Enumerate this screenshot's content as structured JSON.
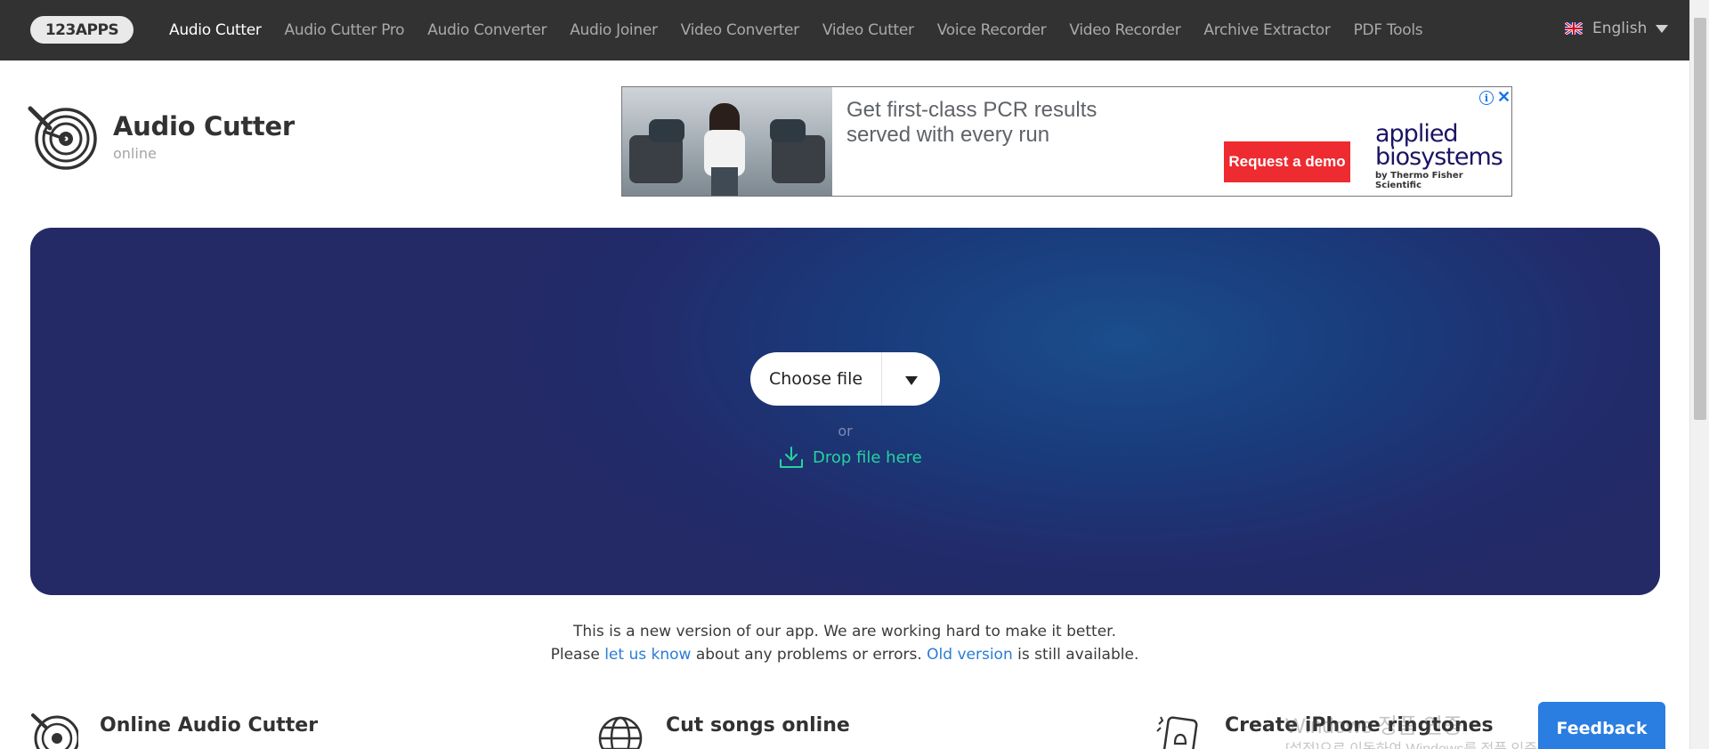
{
  "topbar": {
    "logo": "123APPS",
    "nav": [
      {
        "label": "Audio Cutter",
        "active": true
      },
      {
        "label": "Audio Cutter Pro"
      },
      {
        "label": "Audio Converter"
      },
      {
        "label": "Audio Joiner"
      },
      {
        "label": "Video Converter"
      },
      {
        "label": "Video Cutter"
      },
      {
        "label": "Voice Recorder"
      },
      {
        "label": "Video Recorder"
      },
      {
        "label": "Archive Extractor"
      },
      {
        "label": "PDF Tools"
      }
    ],
    "language": "English"
  },
  "app": {
    "title": "Audio Cutter",
    "subtitle": "online"
  },
  "ad": {
    "headline": "Get first-class PCR results served with every run",
    "cta": "Request a demo",
    "brand_line1": "applied",
    "brand_line2": "biosystems",
    "brand_line3": "by Thermo Fisher Scientific",
    "info": "i",
    "close": "✕"
  },
  "upload": {
    "choose_label": "Choose file",
    "or": "or",
    "drop_label": "Drop file here"
  },
  "notice": {
    "line1": "This is a new version of our app. We are working hard to make it better.",
    "line2_a": "Please ",
    "link1": "let us know",
    "line2_b": " about any problems or errors. ",
    "link2": "Old version",
    "line2_c": " is still available."
  },
  "features": [
    {
      "title": "Online Audio Cutter",
      "icon": "vinyl-icon"
    },
    {
      "title": "Cut songs online",
      "icon": "globe-icon"
    },
    {
      "title": "Create iPhone ringtones",
      "icon": "phone-bell-icon"
    }
  ],
  "watermark": {
    "line1": "Windows 정품 인증",
    "line2": "[설정]으로 이동하여 Windows를 정품 인증합니다."
  },
  "feedback": "Feedback",
  "colors": {
    "topbar": "#323232",
    "accent_green": "#24d4a0",
    "link_blue": "#2b7bd6",
    "feedback_blue": "#2a7de1",
    "panel_blue": "#232a66",
    "ad_red": "#ee2b30"
  }
}
